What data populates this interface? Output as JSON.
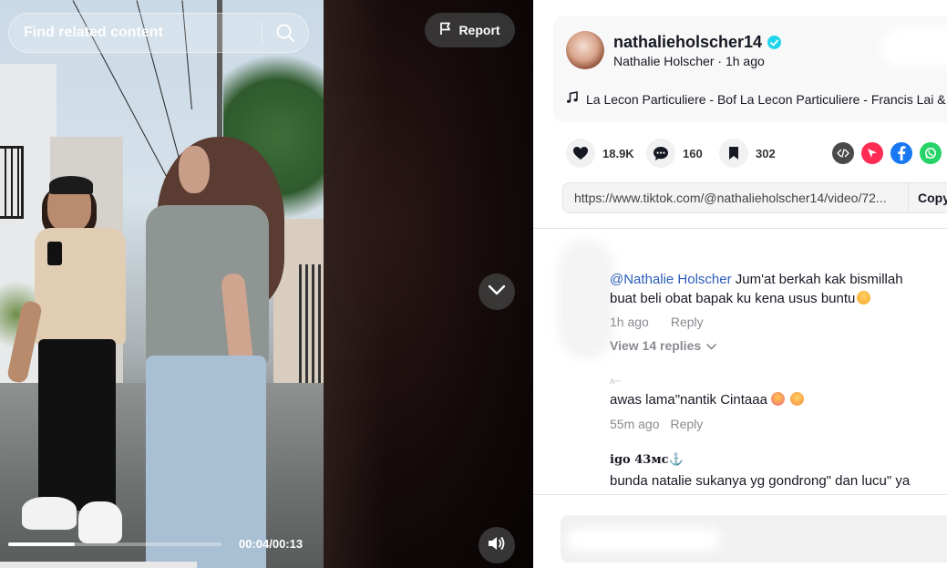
{
  "video": {
    "search_placeholder": "Find related content",
    "report_label": "Report",
    "time": "00:04/00:13",
    "progress": 0.31
  },
  "post": {
    "username": "nathalieholscher14",
    "display_name": "Nathalie Holscher",
    "separator": " · ",
    "time_ago": "1h ago",
    "music": "La Lecon Particuliere - Bof La Lecon Particuliere - Francis Lai &"
  },
  "actions": {
    "likes": "18.9K",
    "comments": "160",
    "saves": "302"
  },
  "share": {
    "link": "https://www.tiktok.com/@nathalieholscher14/video/72...",
    "copy_label": "Copy"
  },
  "comments": [
    {
      "mention": "@Nathalie Holscher",
      "text_line1": " Jum'at berkah kak bismillah",
      "text_line2": "buat beli obat bapak ku kena usus buntu",
      "time": "1h ago",
      "reply_label": "Reply",
      "view_replies": "View 14 replies"
    },
    {
      "name": "ʌ◦◦",
      "text": "awas lama\"nantik Cintaaa",
      "time": "55m ago",
      "reply_label": "Reply"
    },
    {
      "name": "igo 43мс⚓",
      "text": "bunda natalie sukanya yg gondrong\" dan lucu\" ya"
    }
  ],
  "colors": {
    "accent_link": "#2b5db9",
    "verified": "#20d5ec",
    "embed": "#4a4a4a",
    "tiktok_send": "#fe2c55",
    "facebook": "#1877f2",
    "whatsapp": "#25d366"
  }
}
